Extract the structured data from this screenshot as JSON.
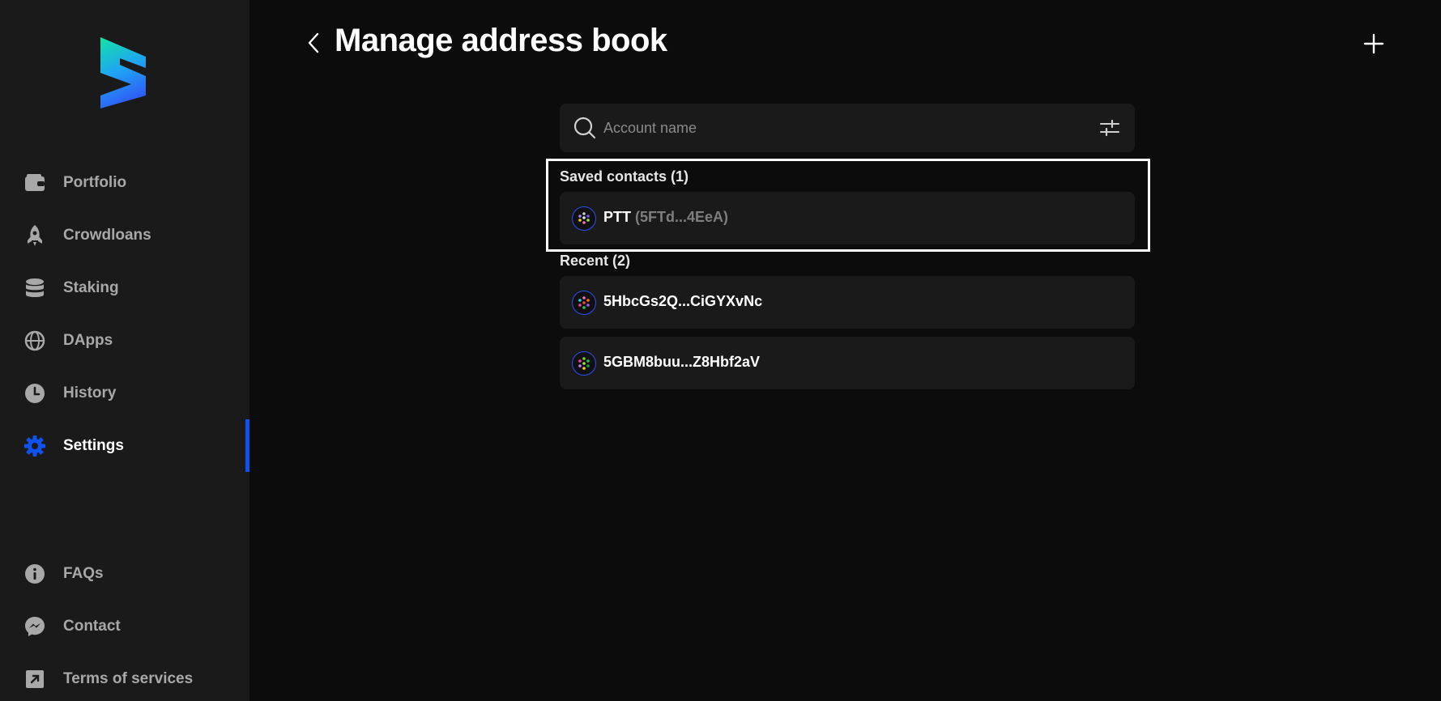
{
  "sidebar": {
    "nav": [
      {
        "label": "Portfolio",
        "icon": "wallet-icon"
      },
      {
        "label": "Crowdloans",
        "icon": "rocket-icon"
      },
      {
        "label": "Staking",
        "icon": "database-icon"
      },
      {
        "label": "DApps",
        "icon": "globe-icon"
      },
      {
        "label": "History",
        "icon": "clock-icon"
      },
      {
        "label": "Settings",
        "icon": "gear-icon"
      }
    ],
    "footer": [
      {
        "label": "FAQs",
        "icon": "info-icon"
      },
      {
        "label": "Contact",
        "icon": "messenger-icon"
      },
      {
        "label": "Terms of services",
        "icon": "external-link-icon"
      }
    ],
    "active": "Settings"
  },
  "header": {
    "title": "Manage address book"
  },
  "search": {
    "placeholder": "Account name"
  },
  "saved": {
    "label": "Saved contacts (1)",
    "items": [
      {
        "name": "PTT",
        "address": "(5FTd...4EeA)"
      }
    ]
  },
  "recent": {
    "label": "Recent (2)",
    "items": [
      {
        "name": "5HbcGs2Q...CiGYXvNc"
      },
      {
        "name": "5GBM8buu...Z8Hbf2aV"
      }
    ]
  },
  "colors": {
    "accent": "#0f52f0",
    "sidebar_bg": "#1a1a1a",
    "page_bg": "#0c0c0c",
    "card_bg": "#1a1a1a"
  }
}
